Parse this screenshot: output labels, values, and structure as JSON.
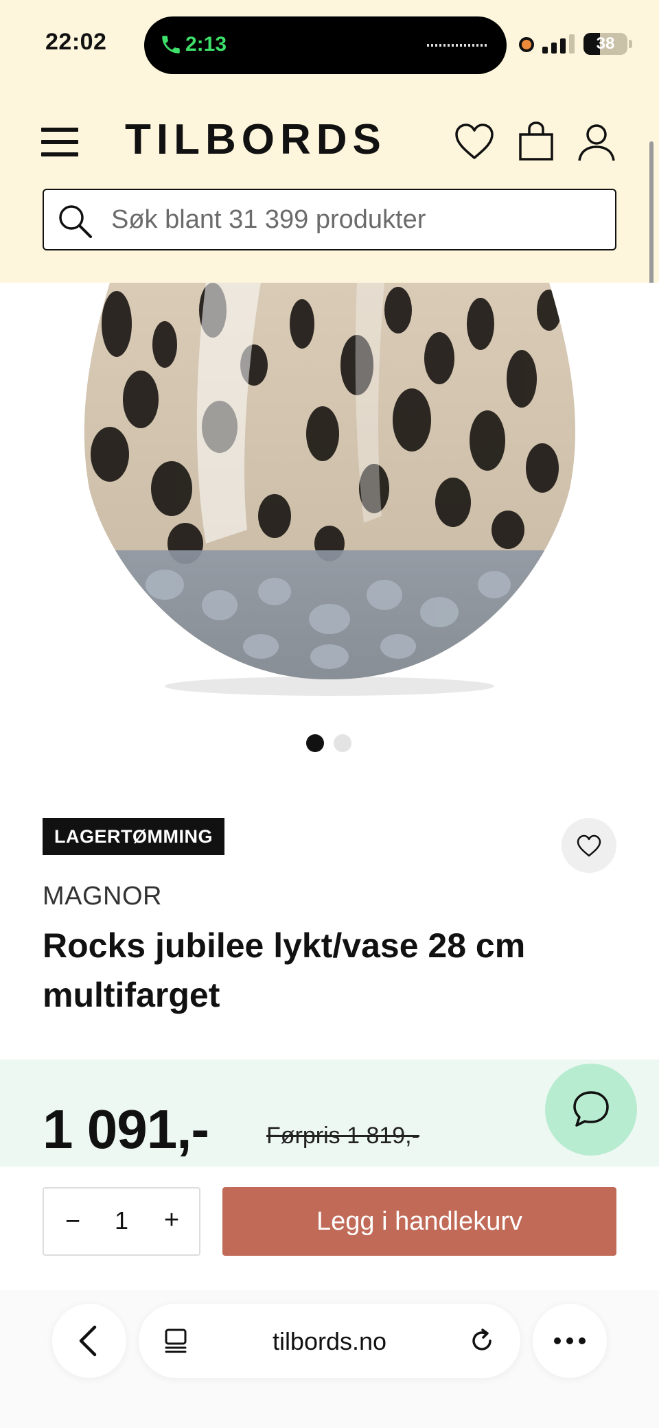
{
  "status_bar": {
    "time": "22:02",
    "call_timer": "2:13",
    "battery_level": "38",
    "battery_fraction": 0.38,
    "icons": [
      "phone-icon",
      "recording-dot-icon",
      "signal-icon",
      "battery-icon"
    ]
  },
  "header": {
    "logo": "TILBORDS",
    "menu_icon": "hamburger-menu-icon",
    "wishlist_icon": "heart-icon",
    "cart_icon": "shopping-bag-icon",
    "account_icon": "user-icon"
  },
  "search": {
    "placeholder": "Søk blant 31 399 produkter",
    "value": "",
    "icon": "search-icon"
  },
  "gallery": {
    "image_alt": "Rocks jubilee lykt/vase",
    "slide_count": 2,
    "active_slide": 1
  },
  "product": {
    "badge": "LAGERTØMMING",
    "brand": "MAGNOR",
    "title": "Rocks jubilee lykt/vase 28 cm multifarget",
    "price": "1 091,-",
    "old_price": "Førpris 1 819,-"
  },
  "cart": {
    "minus": "−",
    "quantity": "1",
    "plus": "+",
    "add_label": "Legg i handlekurv"
  },
  "browser": {
    "url": "tilbords.no",
    "icons": [
      "back-icon",
      "tabs-icon",
      "reload-icon",
      "more-icon"
    ]
  },
  "colors": {
    "header_bg": "#fdf6dc",
    "price_band_bg": "#eef8f3",
    "add_button": "#c06a57",
    "chat_button": "#b8ecd0",
    "badge_bg": "#111111"
  }
}
